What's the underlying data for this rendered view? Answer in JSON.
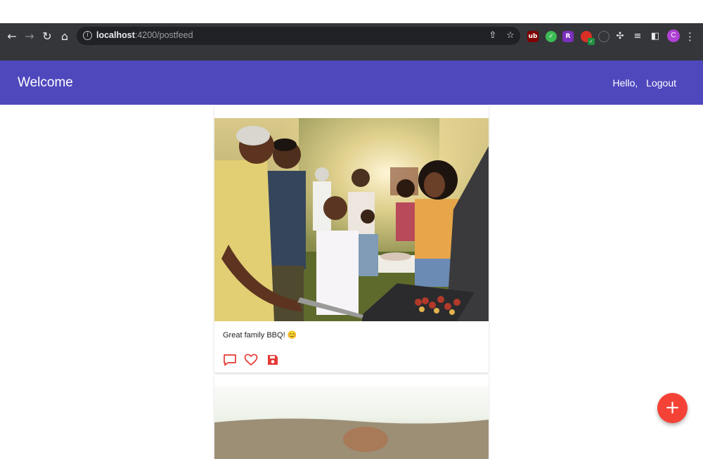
{
  "browser": {
    "url_host": "localhost",
    "url_path": ":4200/postfeed",
    "profile_initial": "C",
    "extensions": [
      "ublock-origin",
      "grammarly",
      "adblock-r",
      "extension-red",
      "extension-gray"
    ]
  },
  "app": {
    "title": "Welcome",
    "greeting": "Hello,",
    "logout_label": "Logout"
  },
  "posts": [
    {
      "caption": "Great family BBQ! 😊",
      "image_subject": "family barbecue outdoors",
      "actions": [
        "comment",
        "like",
        "save"
      ]
    },
    {
      "caption": "",
      "image_subject": "outdoor landscape"
    }
  ],
  "fab": {
    "symbol": "+"
  },
  "colors": {
    "toolbar": "#4f48bd",
    "fab": "#f44336",
    "action_icons": "#e53935",
    "browser_chrome": "#35363a"
  }
}
